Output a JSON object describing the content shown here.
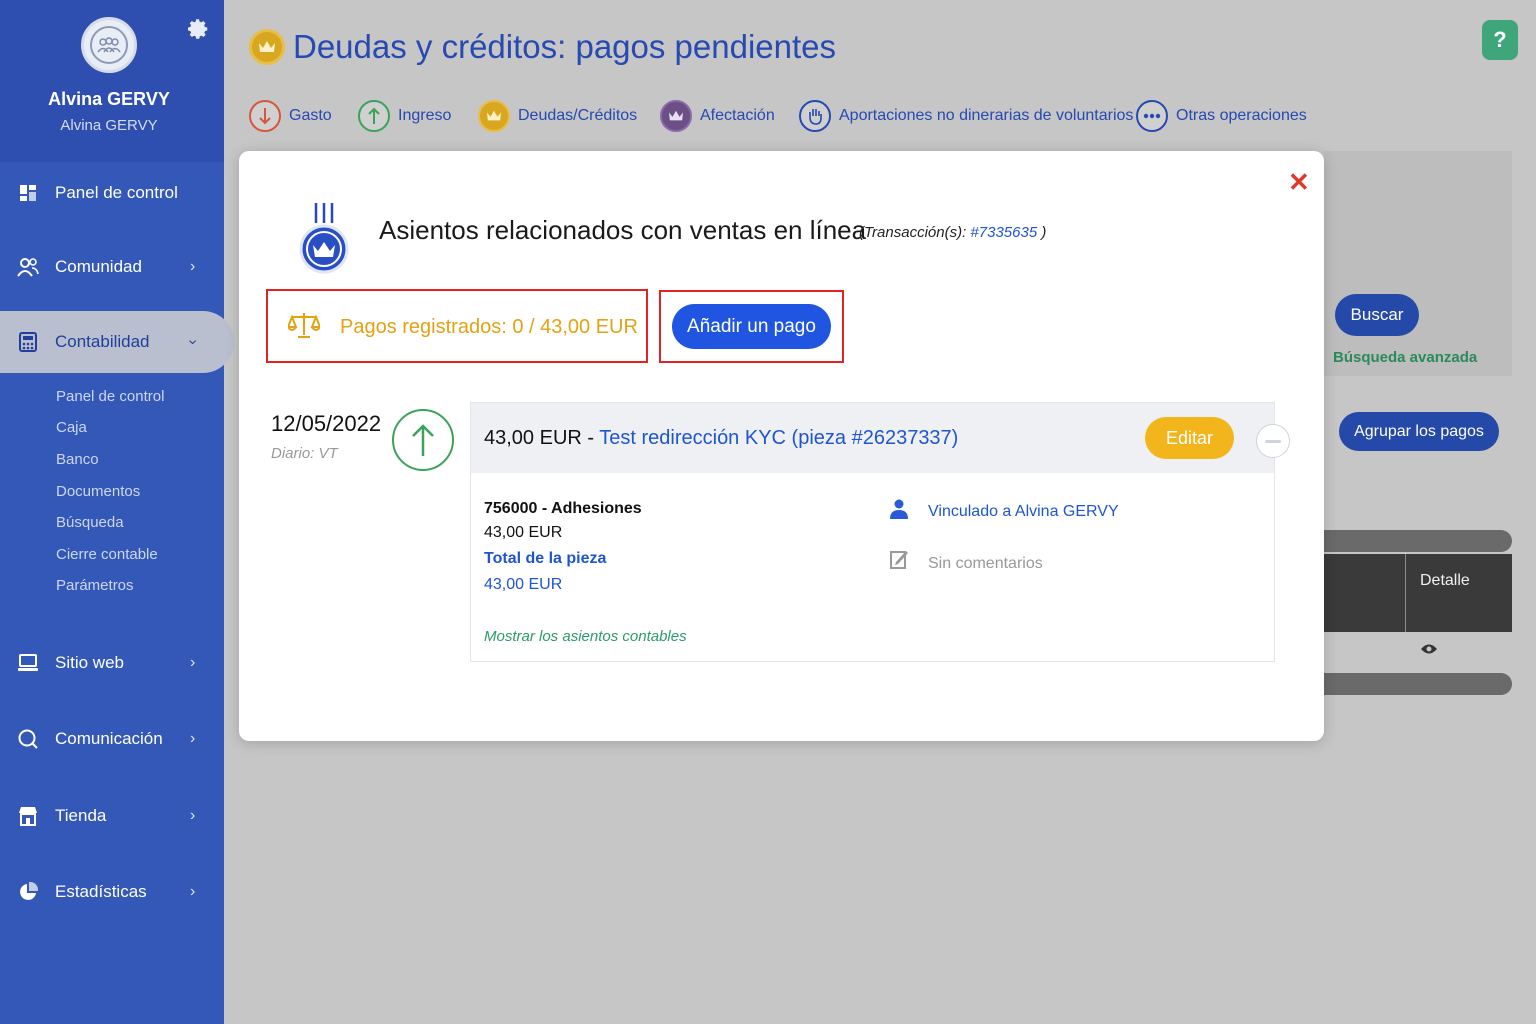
{
  "sidebar": {
    "user_name": "Alvina GERVY",
    "user_sub": "Alvina GERVY",
    "items": [
      {
        "label": "Panel de control",
        "icon": "dashboard-icon"
      },
      {
        "label": "Comunidad",
        "icon": "community-icon"
      },
      {
        "label": "Contabilidad",
        "icon": "calculator-icon"
      },
      {
        "label": "Sitio web",
        "icon": "website-icon"
      },
      {
        "label": "Comunicación",
        "icon": "chat-icon"
      },
      {
        "label": "Tienda",
        "icon": "shop-icon"
      },
      {
        "label": "Estadísticas",
        "icon": "pie-chart-icon"
      }
    ],
    "subitems": [
      "Panel de control",
      "Caja",
      "Banco",
      "Documentos",
      "Búsqueda",
      "Cierre contable",
      "Parámetros"
    ]
  },
  "header": {
    "title": "Deudas y créditos: pagos pendientes",
    "help": "?"
  },
  "tabs": [
    {
      "label": "Gasto",
      "icon": "arrow-down-icon"
    },
    {
      "label": "Ingreso",
      "icon": "arrow-up-icon"
    },
    {
      "label": "Deudas/Créditos",
      "icon": "crown-icon"
    },
    {
      "label": "Afectación",
      "icon": "crown-arrow-icon"
    },
    {
      "label": "Aportaciones no dinerarias de voluntarios",
      "icon": "hand-icon"
    },
    {
      "label": "Otras operaciones",
      "icon": "more-icon"
    }
  ],
  "background": {
    "buscar": "Buscar",
    "busqueda_avanzada": "Búsqueda avanzada",
    "agrupar": "Agrupar los pagos",
    "detalle": "Detalle"
  },
  "modal": {
    "title": "Asientos relacionados con ventas en línea",
    "transaccion_label": "(Transacción(s): ",
    "transaccion_id": "#7335635",
    "transaccion_end": " )",
    "pagos_registrados": "Pagos registrados: 0 / 43,00 EUR",
    "add_payment": "Añadir un pago",
    "entry": {
      "date": "12/05/2022",
      "diario": "Diario: VT",
      "amount": "43,00 EUR - ",
      "link": "Test redirección KYC (pieza #26237337)",
      "edit": "Editar",
      "account": "756000 - Adhesiones",
      "account_amount": "43,00 EUR",
      "total_label": "Total de la pieza",
      "total_value": "43,00 EUR",
      "show_entries": "Mostrar los asientos contables",
      "linked": "Vinculado a Alvina GERVY",
      "comments": "Sin comentarios"
    }
  },
  "colors": {
    "sidebar": "#3358b8",
    "primary": "#1f55e0",
    "warning": "#f2b51c",
    "success": "#3aa35a",
    "danger": "#e52222"
  }
}
